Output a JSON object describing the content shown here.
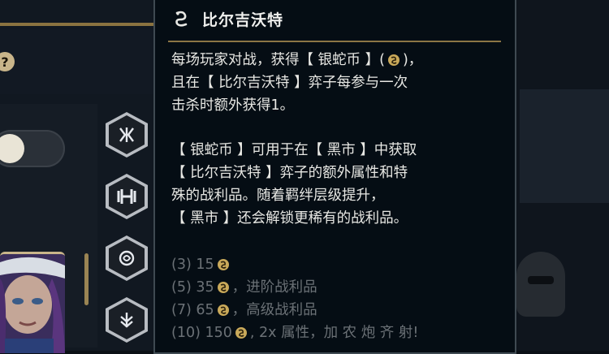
{
  "tooltip": {
    "title": "比尔吉沃特",
    "description_lines": [
      "每场玩家对战，获得【 银蛇币 】(",
      ")，",
      "且在【 比尔吉沃特 】弈子每参与一次",
      "击杀时额外获得1。"
    ],
    "info_lines": [
      "【 银蛇币 】可用于在【 黑市 】中获取",
      "【 比尔吉沃特 】弈子的额外属性和特",
      "殊的战利品。随着羁绊层级提升，",
      "【 黑市 】还会解锁更稀有的战利品。"
    ],
    "tiers": [
      {
        "count": "(3) 15",
        "reward": ""
      },
      {
        "count": "(5) 35",
        "reward": "，进阶战利品"
      },
      {
        "count": "(7) 65",
        "reward": "，高级战利品"
      },
      {
        "count": "(10) 150",
        "reward": ", 2x 属性，加 农 炮 齐 射!"
      }
    ]
  },
  "background": {
    "help_badge": "?"
  },
  "colors": {
    "gold_divider": "#8c7645",
    "coin": "#c9a95a",
    "text": "#e8e8e4",
    "inactive_tier": "#6b7176"
  },
  "icons": {
    "title": "serpent-trait-icon",
    "coin": "silver-serpent-coin-icon",
    "traits": [
      "duelist-trait-icon",
      "bruiser-trait-icon",
      "bilgewater-trait-icon",
      "warden-trait-icon"
    ]
  }
}
